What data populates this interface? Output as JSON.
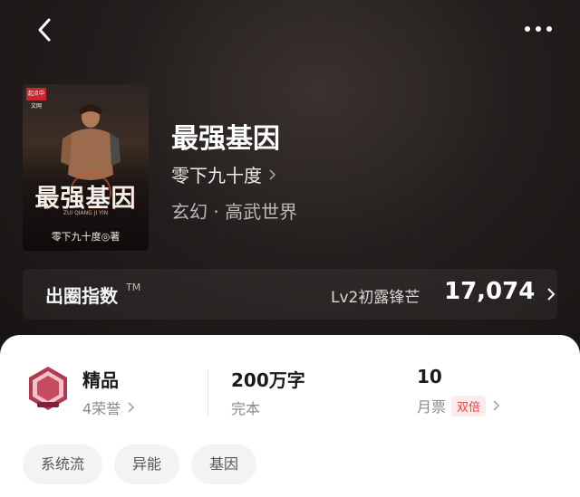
{
  "colors": {
    "hero_bg": "#1a1716",
    "accent_red": "#e4474b",
    "panel_bg": "#ffffff"
  },
  "header": {
    "back_icon": "chevron-left-icon",
    "more_icon": "more-dots-icon"
  },
  "book": {
    "cover": {
      "publisher": "起点中文网",
      "title": "最强基因",
      "subtitle": "ZUI QIANG JI YIN",
      "author": "零下九十度◎著"
    },
    "title": "最强基因",
    "author": "零下九十度",
    "genre": "玄幻 · 高武世界"
  },
  "popularity": {
    "label": "出圈指数",
    "trademark": "TM",
    "level": "Lv2初露锋芒",
    "value": "17,074"
  },
  "stats": {
    "honor": {
      "title": "精品",
      "count": "4荣誉"
    },
    "words": {
      "value": "200万字",
      "status": "完本"
    },
    "tickets": {
      "value": "10",
      "label": "月票",
      "badge": "双倍"
    }
  },
  "tags": [
    "系统流",
    "异能",
    "基因"
  ]
}
